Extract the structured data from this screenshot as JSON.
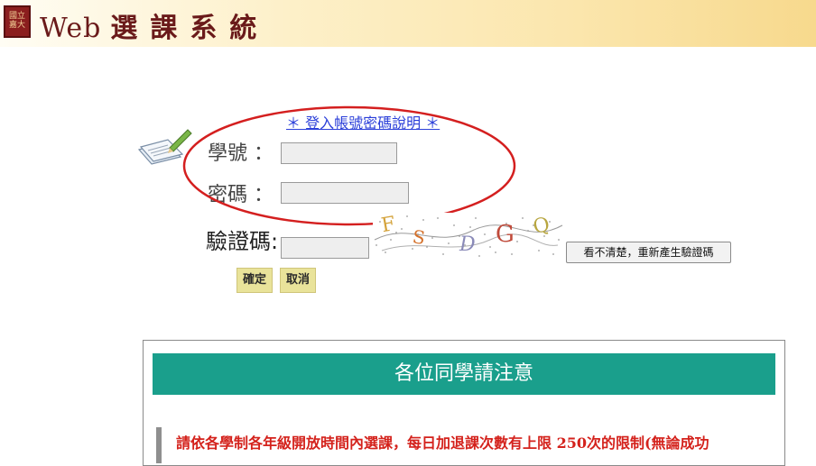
{
  "header": {
    "logo_text": "國立\n嘉大",
    "title_latin": "Web",
    "title_zh": "選課系統"
  },
  "login": {
    "help_link": "＊ 登入帳號密碼說明 ＊",
    "student_id_label": "學號 ：",
    "student_id_value": "",
    "password_label": "密碼 ：",
    "password_value": "",
    "captcha_label": "驗證碼:",
    "captcha_value": "",
    "captcha_chars": [
      "F",
      "S",
      "D",
      "G",
      "Q"
    ],
    "regen_button": "看不清楚，重新產生驗證碼",
    "confirm_button": "確定",
    "cancel_button": "取消"
  },
  "notice": {
    "title": "各位同學請注意",
    "text": "請依各學制各年級開放時間內選課，每日加退課次數有上限 250次的限制(無論成功"
  },
  "colors": {
    "notice_header": "#1a9f8c",
    "notice_text": "#d4221c",
    "annotation": "#d41f1f",
    "link": "#2b3fd9"
  }
}
